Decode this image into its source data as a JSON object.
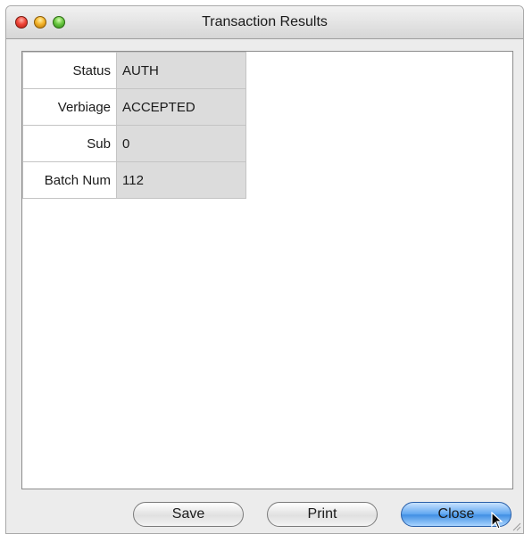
{
  "window": {
    "title": "Transaction Results"
  },
  "results": {
    "rows": [
      {
        "label": "Status",
        "value": "AUTH"
      },
      {
        "label": "Verbiage",
        "value": "ACCEPTED"
      },
      {
        "label": "Sub",
        "value": "0"
      },
      {
        "label": "Batch Num",
        "value": "112"
      }
    ]
  },
  "buttons": {
    "save_label": "Save",
    "print_label": "Print",
    "close_label": "Close"
  },
  "colors": {
    "window_bg": "#ececec",
    "value_cell_bg": "#dcdcdc",
    "default_button": "#5ea6f0"
  }
}
